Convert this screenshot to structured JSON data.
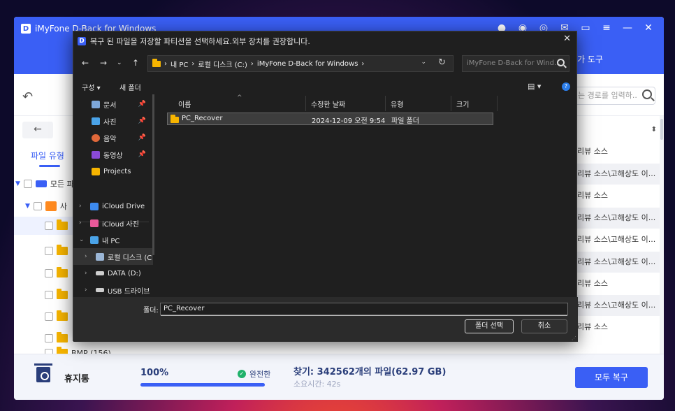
{
  "app": {
    "title": "iMyFone D-Back for Windows",
    "logo_letter": "D",
    "tools_link": "가 도구",
    "path_placeholder": "는 경로를 입력하..",
    "nav_back": "←",
    "tab_file_type": "파일 유형",
    "tree": {
      "all_label": "모든 파",
      "photos_label": "사",
      "bmp_label": "BMP (156)"
    },
    "source_rows": [
      "리뷰 소스",
      "리뷰 소스\\고해상도 이...",
      "리뷰 소스",
      "리뷰 소스\\고해상도 이...",
      "리뷰 소스\\고해상도 이...",
      "리뷰 소스\\고해상도 이...",
      "리뷰 소스",
      "리뷰 소스\\고해상도 이...",
      "리뷰 소스"
    ]
  },
  "bottom": {
    "trash_label": "휴지통",
    "progress_label": "100%",
    "progress_fraction": 1.0,
    "status_label": "완전한",
    "found_label": "찾기: 342562개의 파일(62.97 GB)",
    "elapsed_label": "소요시간: 42s",
    "recover_all_button": "모두 복구"
  },
  "dialog": {
    "logo_letter": "D",
    "title": "복구 된 파일을 저장할 파티션을 선택하세요.외부 장치를 권장합니다.",
    "close": "✕",
    "address": {
      "segments": [
        "내 PC",
        "로컬 디스크 (C:)",
        "iMyFone D-Back for Windows"
      ],
      "separator": "›"
    },
    "search_placeholder": "iMyFone D-Back for Wind...",
    "organize_label": "구성 ▾",
    "new_folder_label": "새 폴더",
    "nav_items": [
      {
        "label": "문서",
        "pinned": true
      },
      {
        "label": "사진",
        "pinned": true
      },
      {
        "label": "음악",
        "pinned": true
      },
      {
        "label": "동영상",
        "pinned": true
      },
      {
        "label": "Projects",
        "pinned": false
      },
      {
        "label": "iCloud Drive",
        "pinned": false
      },
      {
        "label": "iCloud 사진",
        "pinned": false
      },
      {
        "label": "내 PC",
        "pinned": false
      },
      {
        "label": "로컬 디스크 (C",
        "pinned": false
      },
      {
        "label": "DATA (D:)",
        "pinned": false
      },
      {
        "label": "USB 드라이브",
        "pinned": false
      }
    ],
    "columns": {
      "name": "이름",
      "modified": "수정한 날짜",
      "type": "유형",
      "size": "크기"
    },
    "file": {
      "name": "PC_Recover",
      "modified": "2024-12-09 오전 9:54",
      "type": "파일 폴더",
      "size": ""
    },
    "folder_field_label": "폴더:",
    "folder_field_value": "PC_Recover",
    "select_folder_button": "폴더 선택",
    "cancel_button": "취소"
  },
  "colors": {
    "brand_blue": "#3a5ff5",
    "folder_yellow": "#f6b400",
    "dialog_bg": "#1f1f1f",
    "success_green": "#20b26b"
  }
}
